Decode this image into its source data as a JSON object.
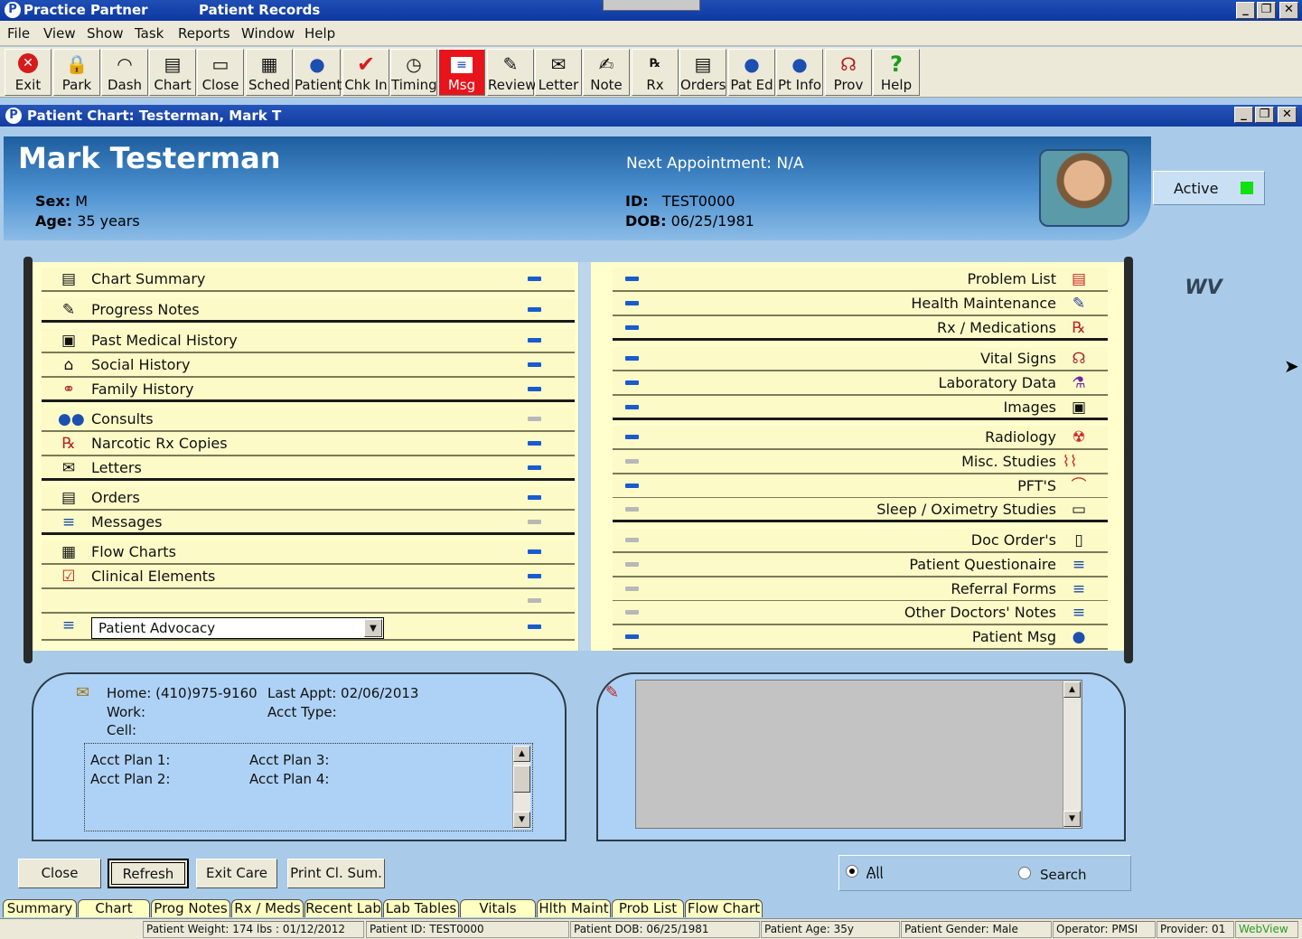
{
  "app": {
    "title": "Practice Partner",
    "module": "Patient Records",
    "logo_glyph": "P"
  },
  "window_controls": {
    "minimize": "_",
    "restore": "❐",
    "close": "✕"
  },
  "menu": [
    "File",
    "View",
    "Show",
    "Task",
    "Reports",
    "Window",
    "Help"
  ],
  "toolbar": [
    {
      "label": "Exit",
      "icon": "exit-icon"
    },
    {
      "label": "Park",
      "icon": "lock-icon"
    },
    {
      "label": "Dash",
      "icon": "dashboard-gauge-icon"
    },
    {
      "label": "Chart",
      "icon": "chart-folder-icon"
    },
    {
      "label": "Close",
      "icon": "close-folder-icon"
    },
    {
      "label": "Sched",
      "icon": "schedule-grid-icon"
    },
    {
      "label": "Patient",
      "icon": "patient-person-icon"
    },
    {
      "label": "Chk In",
      "icon": "checkmark-icon"
    },
    {
      "label": "Timing",
      "icon": "clock-icon"
    },
    {
      "label": "Msg",
      "icon": "message-icon",
      "highlighted": true
    },
    {
      "label": "Review",
      "icon": "review-pen-icon"
    },
    {
      "label": "Letter",
      "icon": "letter-icon"
    },
    {
      "label": "Note",
      "icon": "note-icon"
    },
    {
      "label": "Rx",
      "icon": "rx-icon"
    },
    {
      "label": "Orders",
      "icon": "orders-icon"
    },
    {
      "label": "Pat Ed",
      "icon": "patient-education-icon"
    },
    {
      "label": "Pt Info",
      "icon": "patient-info-icon"
    },
    {
      "label": "Prov",
      "icon": "provider-icon"
    },
    {
      "label": "Help",
      "icon": "help-question-icon"
    }
  ],
  "chart_window": {
    "title": "Patient Chart: Testerman, Mark T"
  },
  "patient": {
    "name": "Mark Testerman",
    "sex_label": "Sex:",
    "sex": "M",
    "age_label": "Age:",
    "age": "35 years",
    "id_label": "ID:",
    "id": "TEST0000",
    "dob_label": "DOB:",
    "dob": "06/25/1981",
    "next_appointment": "Next Appointment: N/A",
    "status": "Active",
    "status_color": "#11e011"
  },
  "left_sections": [
    {
      "label": "Chart Summary",
      "icon": "clipboard-icon",
      "active": true
    },
    {
      "label": "Progress Notes",
      "icon": "progress-notes-icon",
      "active": true
    },
    {
      "label": "Past Medical History",
      "icon": "medical-history-icon",
      "active": true
    },
    {
      "label": "Social History",
      "icon": "house-icon",
      "active": true
    },
    {
      "label": "Family History",
      "icon": "family-tree-icon",
      "active": true
    },
    {
      "label": "Consults",
      "icon": "consults-people-icon",
      "active": false
    },
    {
      "label": "Narcotic Rx Copies",
      "icon": "narcotic-rx-icon",
      "active": true
    },
    {
      "label": "Letters",
      "icon": "letter-icon",
      "active": true
    },
    {
      "label": "Orders",
      "icon": "orders-icon",
      "active": true
    },
    {
      "label": "Messages",
      "icon": "message-icon",
      "active": false
    },
    {
      "label": "Flow Charts",
      "icon": "flow-chart-grid-icon",
      "active": true
    },
    {
      "label": "Clinical Elements",
      "icon": "clinical-check-icon",
      "active": true
    },
    {
      "label": "",
      "icon": "",
      "active": false
    },
    {
      "label": "",
      "icon": "message-icon",
      "active": true
    }
  ],
  "advocacy_select": {
    "value": "Patient Advocacy"
  },
  "right_sections": [
    {
      "label": "Problem List",
      "icon": "problem-list-icon",
      "active": true
    },
    {
      "label": "Health Maintenance",
      "icon": "syringe-icon",
      "active": true
    },
    {
      "label": "Rx / Medications",
      "icon": "rx-medications-icon",
      "active": true
    },
    {
      "label": "Vital Signs",
      "icon": "stethoscope-icon",
      "active": true
    },
    {
      "label": "Laboratory Data",
      "icon": "lab-flask-icon",
      "active": true
    },
    {
      "label": "Images",
      "icon": "camera-icon",
      "active": true
    },
    {
      "label": "Radiology",
      "icon": "radiology-icon",
      "active": true
    },
    {
      "label": "Misc. Studies",
      "icon": "ekg-wave-icon",
      "active": false
    },
    {
      "label": "PFT'S",
      "icon": "pft-curve-icon",
      "active": true
    },
    {
      "label": "Sleep / Oximetry Studies",
      "icon": "sleep-bed-icon",
      "active": false
    },
    {
      "label": "Doc Order's",
      "icon": "document-icon",
      "active": false
    },
    {
      "label": "Patient Questionaire",
      "icon": "form-icon",
      "active": false
    },
    {
      "label": "Referral Forms",
      "icon": "form-icon",
      "active": false
    },
    {
      "label": "Other Doctors' Notes",
      "icon": "form-icon",
      "active": false
    },
    {
      "label": "Patient Msg",
      "icon": "patient-message-icon",
      "active": true
    }
  ],
  "contact": {
    "home": "Home: (410)975-9160",
    "work": "Work:",
    "cell": "Cell:",
    "last_appt": "Last Appt:   02/06/2013",
    "acct_type": "Acct Type:",
    "plans": [
      "Acct Plan 1:",
      "Acct Plan 2:",
      "Acct Plan 3:",
      "Acct Plan 4:"
    ]
  },
  "buttons": [
    "Close",
    "Refresh",
    "Exit Care",
    "Print Cl. Sum."
  ],
  "filter": {
    "all": "All",
    "search": "Search",
    "selected": "All"
  },
  "tabs": [
    "Summary",
    "Chart",
    "Prog Notes",
    "Rx / Meds",
    "Recent Lab",
    "Lab Tables",
    "Vitals",
    "Hlth Maint",
    "Prob List",
    "Flow Chart"
  ],
  "status": {
    "weight": "Patient Weight: 174 lbs : 01/12/2012",
    "id": "Patient ID: TEST0000",
    "dob": "Patient DOB: 06/25/1981",
    "age": "Patient Age: 35y",
    "gender": "Patient Gender: Male",
    "operator": "Operator: PMSI",
    "provider": "Provider: 01",
    "webview": "WebView"
  },
  "webview_badge": "WV"
}
